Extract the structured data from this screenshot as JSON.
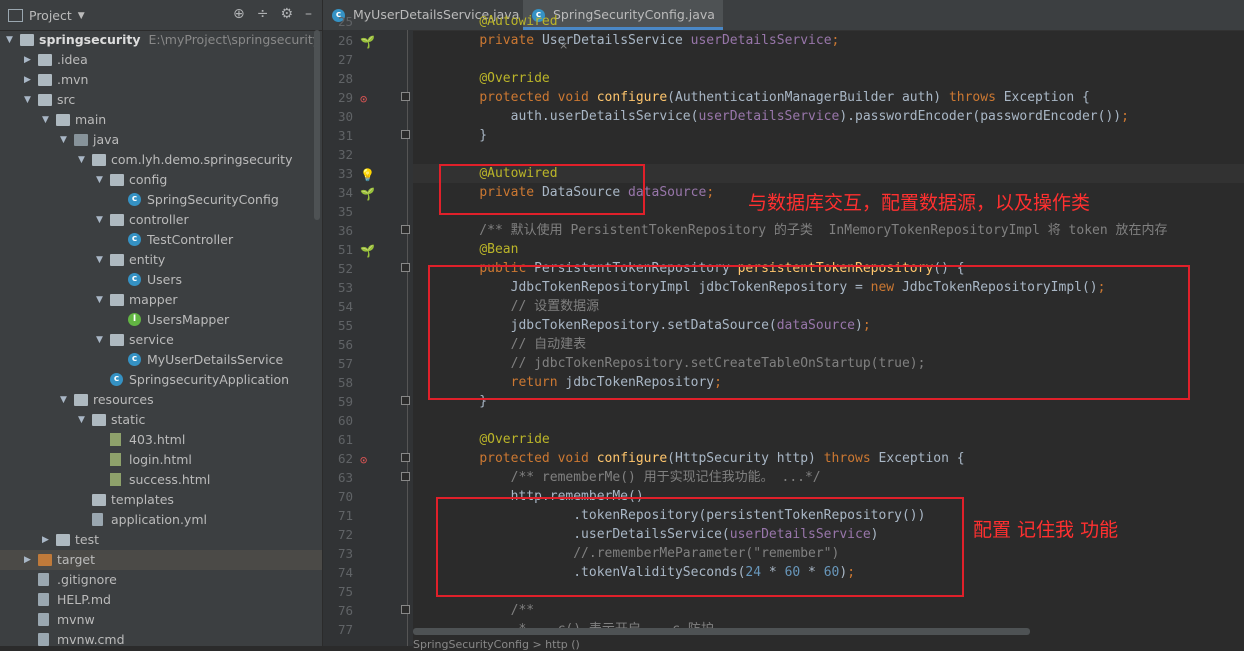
{
  "project_panel": {
    "title": "Project",
    "header_icons": [
      "target-icon",
      "collapse-icon",
      "gear-icon",
      "minimize-icon"
    ],
    "root_name": "springsecurity",
    "root_path": "E:\\myProject\\springsecurity",
    "tree": [
      {
        "label": "springsecurity",
        "level": 0,
        "type": "module",
        "expanded": true
      },
      {
        "label": ".idea",
        "level": 1,
        "type": "folder",
        "expanded": false
      },
      {
        "label": ".mvn",
        "level": 1,
        "type": "folder",
        "expanded": false
      },
      {
        "label": "src",
        "level": 1,
        "type": "folder",
        "expanded": true
      },
      {
        "label": "main",
        "level": 2,
        "type": "folder",
        "expanded": true
      },
      {
        "label": "java",
        "level": 3,
        "type": "source-folder",
        "expanded": true
      },
      {
        "label": "com.lyh.demo.springsecurity",
        "level": 4,
        "type": "package",
        "expanded": true
      },
      {
        "label": "config",
        "level": 5,
        "type": "package",
        "expanded": true
      },
      {
        "label": "SpringSecurityConfig",
        "level": 6,
        "type": "class"
      },
      {
        "label": "controller",
        "level": 5,
        "type": "package",
        "expanded": true
      },
      {
        "label": "TestController",
        "level": 6,
        "type": "class"
      },
      {
        "label": "entity",
        "level": 5,
        "type": "package",
        "expanded": true
      },
      {
        "label": "Users",
        "level": 6,
        "type": "class"
      },
      {
        "label": "mapper",
        "level": 5,
        "type": "package",
        "expanded": true
      },
      {
        "label": "UsersMapper",
        "level": 6,
        "type": "interface"
      },
      {
        "label": "service",
        "level": 5,
        "type": "package",
        "expanded": true
      },
      {
        "label": "MyUserDetailsService",
        "level": 6,
        "type": "class"
      },
      {
        "label": "SpringsecurityApplication",
        "level": 5,
        "type": "spring-class"
      },
      {
        "label": "resources",
        "level": 3,
        "type": "resource-folder",
        "expanded": true
      },
      {
        "label": "static",
        "level": 4,
        "type": "folder",
        "expanded": true
      },
      {
        "label": "403.html",
        "level": 5,
        "type": "html"
      },
      {
        "label": "login.html",
        "level": 5,
        "type": "html"
      },
      {
        "label": "success.html",
        "level": 5,
        "type": "html"
      },
      {
        "label": "templates",
        "level": 4,
        "type": "folder"
      },
      {
        "label": "application.yml",
        "level": 4,
        "type": "yml"
      },
      {
        "label": "test",
        "level": 2,
        "type": "folder",
        "expanded": false
      },
      {
        "label": "target",
        "level": 1,
        "type": "excluded-folder",
        "expanded": false,
        "selected": true
      },
      {
        "label": ".gitignore",
        "level": 1,
        "type": "file"
      },
      {
        "label": "HELP.md",
        "level": 1,
        "type": "md"
      },
      {
        "label": "mvnw",
        "level": 1,
        "type": "file"
      },
      {
        "label": "mvnw.cmd",
        "level": 1,
        "type": "file"
      }
    ]
  },
  "tabs": [
    {
      "label": "MyUserDetailsService.java",
      "active": false,
      "close": "×"
    },
    {
      "label": "SpringSecurityConfig.java",
      "active": true,
      "close": "×"
    }
  ],
  "code_lines": [
    {
      "n": "25",
      "parts": [
        {
          "t": "    "
        },
        {
          "t": "@Autowired",
          "c": "an"
        }
      ]
    },
    {
      "n": "26",
      "gutter": "bean-icon",
      "parts": [
        {
          "t": "    "
        },
        {
          "t": "private ",
          "c": "kw"
        },
        {
          "t": "UserDetailsService "
        },
        {
          "t": "userDetailsService",
          "c": "fl"
        },
        {
          "t": ";",
          "c": "kw"
        }
      ]
    },
    {
      "n": "27",
      "parts": []
    },
    {
      "n": "28",
      "parts": [
        {
          "t": "    "
        },
        {
          "t": "@Override",
          "c": "an"
        }
      ]
    },
    {
      "n": "29",
      "gutter": "override-icon",
      "fold": true,
      "parts": [
        {
          "t": "    "
        },
        {
          "t": "protected void ",
          "c": "kw"
        },
        {
          "t": "configure",
          "c": "fn"
        },
        {
          "t": "(AuthenticationManagerBuilder auth) "
        },
        {
          "t": "throws ",
          "c": "kw"
        },
        {
          "t": "Exception {"
        }
      ]
    },
    {
      "n": "30",
      "parts": [
        {
          "t": "        auth.userDetailsService("
        },
        {
          "t": "userDetailsService",
          "c": "fl"
        },
        {
          "t": ").passwordEncoder(passwordEncoder())"
        },
        {
          "t": ";",
          "c": "kw"
        }
      ]
    },
    {
      "n": "31",
      "fold": true,
      "parts": [
        {
          "t": "    }"
        }
      ]
    },
    {
      "n": "32",
      "parts": []
    },
    {
      "n": "33",
      "gutter": "bulb-icon",
      "highlight": true,
      "parts": [
        {
          "t": "    "
        },
        {
          "t": "@Autowired",
          "c": "an"
        }
      ]
    },
    {
      "n": "34",
      "gutter": "bean-icon",
      "parts": [
        {
          "t": "    "
        },
        {
          "t": "private ",
          "c": "kw"
        },
        {
          "t": "DataSource "
        },
        {
          "t": "dataSource",
          "c": "fl"
        },
        {
          "t": ";",
          "c": "kw"
        }
      ]
    },
    {
      "n": "35",
      "parts": []
    },
    {
      "n": "36",
      "fold": true,
      "parts": [
        {
          "t": "    /** 默认使用 PersistentTokenRepository 的子类  InMemoryTokenRepositoryImpl 将 token 放在内存",
          "c": "cm"
        }
      ]
    },
    {
      "n": "51",
      "gutter": "bean-icon",
      "parts": [
        {
          "t": "    "
        },
        {
          "t": "@Bean",
          "c": "an"
        }
      ]
    },
    {
      "n": "52",
      "fold": true,
      "parts": [
        {
          "t": "    "
        },
        {
          "t": "public ",
          "c": "kw"
        },
        {
          "t": "PersistentTokenRepository "
        },
        {
          "t": "persistentTokenRepository",
          "c": "fn"
        },
        {
          "t": "() {"
        }
      ]
    },
    {
      "n": "53",
      "parts": [
        {
          "t": "        JdbcTokenRepositoryImpl jdbcTokenRepository = "
        },
        {
          "t": "new ",
          "c": "kw"
        },
        {
          "t": "JdbcTokenRepositoryImpl()"
        },
        {
          "t": ";",
          "c": "kw"
        }
      ]
    },
    {
      "n": "54",
      "parts": [
        {
          "t": "        // 设置数据源",
          "c": "cm"
        }
      ]
    },
    {
      "n": "55",
      "parts": [
        {
          "t": "        jdbcTokenRepository.setDataSource("
        },
        {
          "t": "dataSource",
          "c": "fl"
        },
        {
          "t": ")"
        },
        {
          "t": ";",
          "c": "kw"
        }
      ]
    },
    {
      "n": "56",
      "parts": [
        {
          "t": "        // 自动建表",
          "c": "cm"
        }
      ]
    },
    {
      "n": "57",
      "parts": [
        {
          "t": "        // jdbcTokenRepository.setCreateTableOnStartup(true);",
          "c": "cm"
        }
      ]
    },
    {
      "n": "58",
      "parts": [
        {
          "t": "        "
        },
        {
          "t": "return ",
          "c": "kw"
        },
        {
          "t": "jdbcTokenRepository"
        },
        {
          "t": ";",
          "c": "kw"
        }
      ]
    },
    {
      "n": "59",
      "fold": true,
      "parts": [
        {
          "t": "    }"
        }
      ]
    },
    {
      "n": "60",
      "parts": []
    },
    {
      "n": "61",
      "parts": [
        {
          "t": "    "
        },
        {
          "t": "@Override",
          "c": "an"
        }
      ]
    },
    {
      "n": "62",
      "gutter": "override-icon",
      "fold": true,
      "parts": [
        {
          "t": "    "
        },
        {
          "t": "protected void ",
          "c": "kw"
        },
        {
          "t": "configure",
          "c": "fn"
        },
        {
          "t": "(HttpSecurity http) "
        },
        {
          "t": "throws ",
          "c": "kw"
        },
        {
          "t": "Exception {"
        }
      ]
    },
    {
      "n": "63",
      "fold": true,
      "parts": [
        {
          "t": "        "
        },
        {
          "t": "/** rememberMe() 用于实现记住我功能。 ...*/",
          "c": "cm"
        }
      ]
    },
    {
      "n": "70",
      "parts": [
        {
          "t": "        http.rememberMe()"
        }
      ]
    },
    {
      "n": "71",
      "parts": [
        {
          "t": "                .tokenRepository(persistentTokenRepository())"
        }
      ]
    },
    {
      "n": "72",
      "parts": [
        {
          "t": "                .userDetailsService("
        },
        {
          "t": "userDetailsService",
          "c": "fl"
        },
        {
          "t": ")"
        }
      ]
    },
    {
      "n": "73",
      "parts": [
        {
          "t": "                //.rememberMeParameter(\"remember\")",
          "c": "cm"
        }
      ]
    },
    {
      "n": "74",
      "parts": [
        {
          "t": "                .tokenValiditySeconds("
        },
        {
          "t": "24 ",
          "c": "nm"
        },
        {
          "t": "* "
        },
        {
          "t": "60 ",
          "c": "nm"
        },
        {
          "t": "* "
        },
        {
          "t": "60",
          "c": "nm"
        },
        {
          "t": ")"
        },
        {
          "t": ";",
          "c": "kw"
        }
      ]
    },
    {
      "n": "75",
      "parts": []
    },
    {
      "n": "76",
      "fold": true,
      "parts": [
        {
          "t": "        "
        },
        {
          "t": "/**",
          "c": "cm"
        }
      ]
    },
    {
      "n": "77",
      "parts": [
        {
          "t": "         *   .c() 表示开启    c 防护",
          "c": "cm"
        }
      ]
    }
  ],
  "annotations": {
    "note_datasource": "与数据库交互，配置数据源，以及操作类",
    "note_rememberme": "配置 记住我 功能"
  },
  "status_text": "SpringSecurityConfig > http ()",
  "colors": {
    "annotation_red": "#e0202a",
    "keyword": "#cc7832",
    "annotation": "#bbb529",
    "function": "#ffc66d",
    "field": "#9876aa",
    "comment": "#808080",
    "number": "#6897bb"
  }
}
